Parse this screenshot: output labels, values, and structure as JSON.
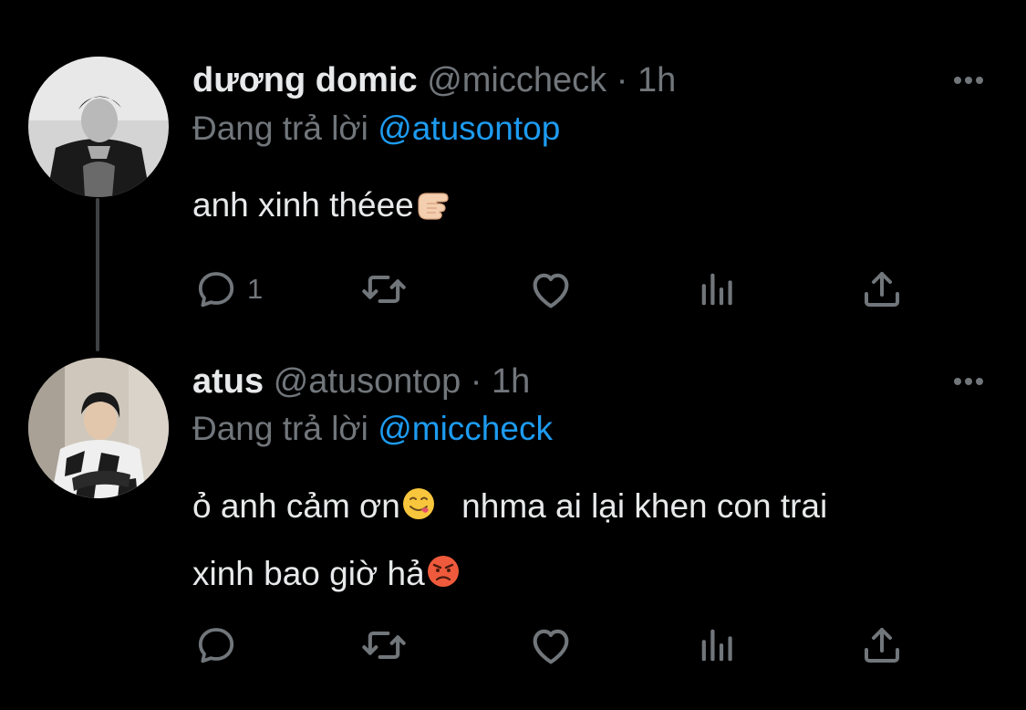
{
  "tweets": [
    {
      "name": "dương domic",
      "handle": "@miccheck",
      "separator": "·",
      "time": "1h",
      "reply_prefix": "Đang trả lời",
      "reply_to": "@atusontop",
      "text_lines": [
        "anh xinh théee"
      ],
      "emojis": [
        "pointing-fist-emoji"
      ],
      "actions": {
        "reply_count": "1",
        "retweet_count": "",
        "like_count": ""
      }
    },
    {
      "name": "atus",
      "handle": "@atusontop",
      "separator": "·",
      "time": "1h",
      "reply_prefix": "Đang trả lời",
      "reply_to": "@miccheck",
      "text_lines": [
        "ỏ anh cảm ơn",
        "nhma ai lại khen con trai",
        "xinh bao giờ hả"
      ],
      "emojis": [
        "yum-face-emoji",
        "angry-face-emoji"
      ],
      "actions": {
        "reply_count": "",
        "retweet_count": "",
        "like_count": ""
      }
    }
  ],
  "icons": {
    "reply": "reply-icon",
    "retweet": "retweet-icon",
    "like": "heart-icon",
    "views": "analytics-icon",
    "share": "share-icon",
    "more": "more-icon"
  },
  "colors": {
    "background": "#000000",
    "primary_text": "#e7e9ea",
    "secondary_text": "#71767b",
    "accent": "#1d9bf0",
    "thread_line": "#3e4144"
  }
}
